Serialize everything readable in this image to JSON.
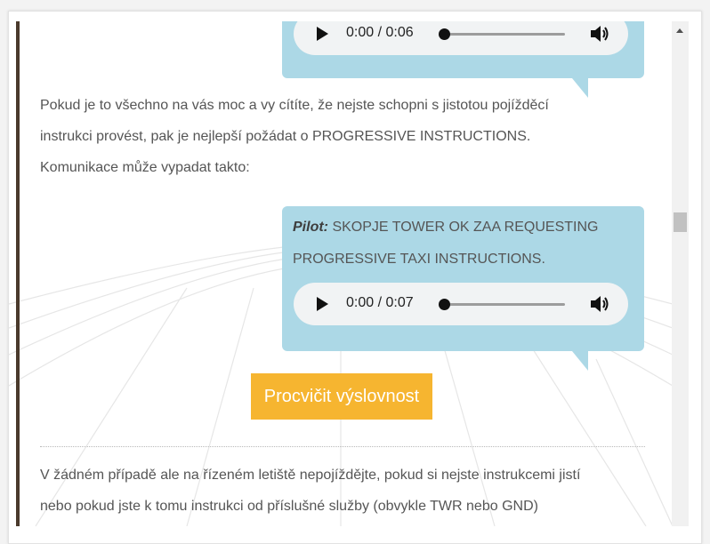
{
  "audio_top": {
    "time": "0:00 / 0:06",
    "progress": 0.0
  },
  "paragraph1": {
    "line1": "Pokud je to všechno na vás moc a vy cítíte, že nejste schopni s jistotou pojížděcí",
    "line2": "instrukci provést, pak je nejlepší požádat o PROGRESSIVE INSTRUCTIONS.",
    "line3": "Komunikace může vypadat takto:"
  },
  "pilot_bubble": {
    "speaker": "Pilot:",
    "text": " SKOPJE TOWER OK ZAA REQUESTING PROGRESSIVE TAXI INSTRUCTIONS.",
    "audio": {
      "time": "0:00 / 0:07",
      "progress": 0.0
    }
  },
  "practice_button": {
    "label": "Procvičit výslovnost"
  },
  "paragraph2": {
    "line1": "V žádném případě ale na řízeném letiště nepojíždějte, pokud si nejste instrukcemi jistí",
    "line2": "nebo pokud jste k tomu instrukci od příslušné služby (obvykle TWR nebo GND)"
  },
  "colors": {
    "bubble": "#acd8e6",
    "button": "#f6b530",
    "left_bar": "#4a3a2c",
    "text": "#555555"
  },
  "icons": [
    "play-icon",
    "volume-icon",
    "scroll-up-arrow-icon"
  ]
}
